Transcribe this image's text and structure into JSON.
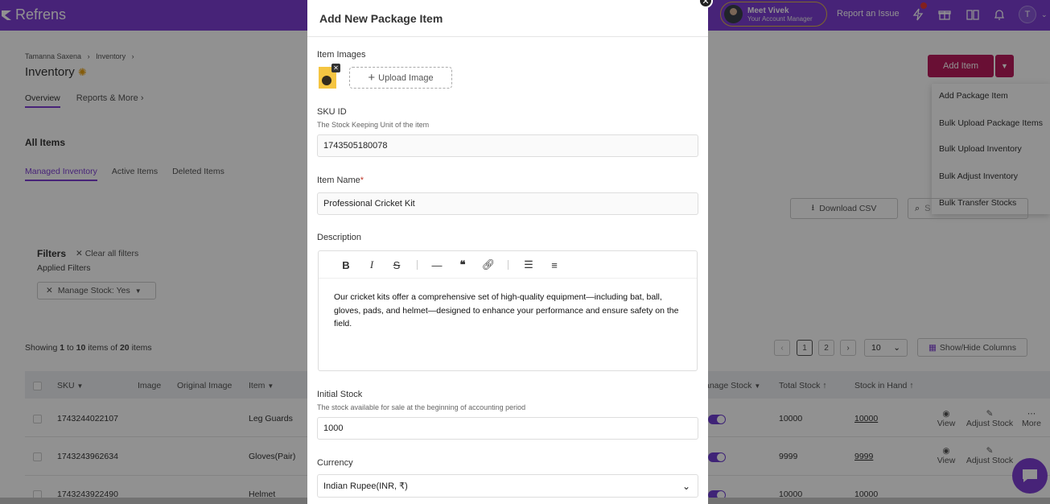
{
  "app": {
    "brand": "Refrens",
    "brand_color": "#7d3fd3"
  },
  "topbar": {
    "manager_name": "Meet Vivek",
    "manager_role": "Your Account Manager",
    "report_issue": "Report an Issue",
    "avatar_letter": "T",
    "icons": [
      "bolt-icon",
      "gift-icon",
      "book-icon",
      "bell-icon"
    ]
  },
  "page": {
    "breadcrumb": [
      "Tamanna Saxena",
      "Inventory"
    ],
    "title": "Inventory",
    "tabs": [
      "Overview",
      "Reports & More"
    ]
  },
  "actions": {
    "add_item": "Add Item",
    "menu": [
      "Add Package Item",
      "Bulk Upload Package Items",
      "Bulk Upload Inventory",
      "Bulk Adjust Inventory",
      "Bulk Transfer Stocks"
    ]
  },
  "list": {
    "heading": "All Items",
    "tabs": [
      "Managed Inventory",
      "Active Items",
      "Deleted Items"
    ],
    "download_csv": "Download CSV",
    "search_placeholder": "S",
    "filters_title": "Filters",
    "clear_filters": "Clear all filters",
    "applied_filters": "Applied Filters",
    "filter_chip": "Manage Stock: Yes",
    "showing_prefix": "Showing",
    "showing_from": "1",
    "showing_to_word": "to",
    "showing_to": "10",
    "showing_of_word": "items of",
    "showing_total": "20",
    "showing_suffix": "items",
    "pages": [
      "1",
      "2"
    ],
    "page_size": "10",
    "show_hide": "Show/Hide Columns",
    "columns": [
      "SKU",
      "Image",
      "Original Image",
      "Item",
      "anage Stock",
      "Total Stock",
      "Stock in Hand"
    ],
    "rows": [
      {
        "sku": "1743244022107",
        "item": "Leg Guards",
        "total": "10000",
        "hand": "10000"
      },
      {
        "sku": "1743243962634",
        "item": "Gloves(Pair)",
        "total": "9999",
        "hand": "9999"
      },
      {
        "sku": "1743243922490",
        "item": "Helmet",
        "total": "10000",
        "hand": "10000"
      }
    ],
    "row_actions": [
      "View",
      "Adjust Stock",
      "More"
    ]
  },
  "modal": {
    "title": "Add New Package Item",
    "images_label": "Item Images",
    "upload_label": "Upload Image",
    "sku_label": "SKU ID",
    "sku_hint": "The Stock Keeping Unit of the item",
    "sku_value": "1743505180078",
    "name_label": "Item Name",
    "required_mark": "*",
    "name_value": "Professional Cricket Kit",
    "desc_label": "Description",
    "desc_value": "Our cricket kits offer a comprehensive set of high-quality equipment—including bat, ball, gloves, pads, and helmet—designed to enhance your performance and ensure safety on the field.",
    "stock_label": "Initial Stock",
    "stock_hint": "The stock available for sale at the beginning of accounting period",
    "stock_value": "1000",
    "currency_label": "Currency",
    "currency_value": "Indian Rupee(INR, ₹)"
  }
}
